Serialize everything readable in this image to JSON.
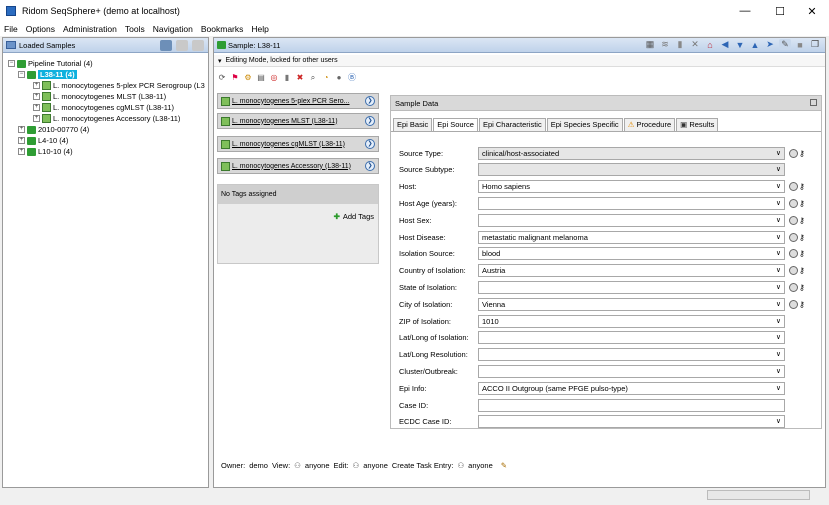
{
  "window": {
    "title": "Ridom SeqSphere+ (demo at localhost)",
    "minimize": "—",
    "maximize": "☐",
    "close": "✕"
  },
  "menu": [
    "File",
    "Options",
    "Administration",
    "Tools",
    "Navigation",
    "Bookmarks",
    "Help"
  ],
  "left_panel": {
    "title": "Loaded Samples",
    "tree": [
      {
        "label": "Pipeline Tutorial (4)",
        "toggle": "−"
      },
      {
        "label": "L38-11 (4)",
        "toggle": "−"
      },
      {
        "label": "L. monocytogenes 5-plex PCR Serogroup (L3",
        "toggle": "+"
      },
      {
        "label": "L. monocytogenes MLST (L38-11)",
        "toggle": "+"
      },
      {
        "label": "L. monocytogenes cgMLST (L38-11)",
        "toggle": "+"
      },
      {
        "label": "L. monocytogenes Accessory (L38-11)",
        "toggle": "+"
      },
      {
        "label": "2010-00770 (4)",
        "toggle": "+"
      },
      {
        "label": "L4-10 (4)",
        "toggle": "+"
      },
      {
        "label": "L10-10 (4)",
        "toggle": "+"
      }
    ]
  },
  "right_panel": {
    "title": "Sample: L38-11",
    "edit_mode": "Editing Mode, locked for other users",
    "schemes": [
      "L. monocytogenes 5-plex PCR Sero...",
      "L. monocytogenes MLST (L38-11)",
      "L. monocytogenes cgMLST (L38-11)",
      "L. monocytogenes Accessory (L38-11)"
    ],
    "tags": {
      "status": "No Tags assigned",
      "add_label": "Add Tags"
    },
    "sample_data": {
      "title": "Sample Data",
      "tabs": [
        "Epi Basic",
        "Epi Source",
        "Epi Characteristic",
        "Epi Species Specific",
        "Procedure",
        "Results"
      ],
      "active_tab": "Epi Source",
      "fields": [
        {
          "label": "Source Type:",
          "value": "clinical/host-associated",
          "dropdown": true,
          "gray": true,
          "icons": true
        },
        {
          "label": "Source Subtype:",
          "value": "",
          "dropdown": true,
          "gray": true,
          "icons": false
        },
        {
          "label": "Host:",
          "value": "Homo sapiens",
          "dropdown": true,
          "gray": false,
          "icons": true
        },
        {
          "label": "Host Age (years):",
          "value": "",
          "dropdown": true,
          "gray": false,
          "icons": true
        },
        {
          "label": "Host Sex:",
          "value": "",
          "dropdown": true,
          "gray": false,
          "icons": true
        },
        {
          "label": "Host Disease:",
          "value": "metastatic malignant melanoma",
          "dropdown": true,
          "gray": false,
          "icons": true
        },
        {
          "label": "Isolation Source:",
          "value": "blood",
          "dropdown": true,
          "gray": false,
          "icons": true
        },
        {
          "label": "Country of Isolation:",
          "value": "Austria",
          "dropdown": true,
          "gray": false,
          "icons": true
        },
        {
          "label": "State of Isolation:",
          "value": "",
          "dropdown": true,
          "gray": false,
          "icons": true
        },
        {
          "label": "City of Isolation:",
          "value": "Vienna",
          "dropdown": true,
          "gray": false,
          "icons": true
        },
        {
          "label": "ZIP of Isolation:",
          "value": "1010",
          "dropdown": true,
          "gray": false,
          "icons": false
        },
        {
          "label": "Lat/Long of Isolation:",
          "value": "",
          "dropdown": true,
          "gray": false,
          "icons": false
        },
        {
          "label": "Lat/Long Resolution:",
          "value": "",
          "dropdown": true,
          "gray": false,
          "icons": false
        },
        {
          "label": "Cluster/Outbreak:",
          "value": "",
          "dropdown": true,
          "gray": false,
          "icons": false
        },
        {
          "label": "Epi Info:",
          "value": "ACCO II Outgroup (same PFGE pulso-type)",
          "dropdown": true,
          "gray": false,
          "icons": false
        },
        {
          "label": "Case ID:",
          "value": "",
          "dropdown": false,
          "gray": false,
          "icons": false
        },
        {
          "label": "ECDC Case ID:",
          "value": "",
          "dropdown": true,
          "gray": false,
          "icons": false
        }
      ]
    },
    "footer": {
      "owner_label": "Owner:",
      "owner": "demo",
      "view_label": "View:",
      "view": "anyone",
      "edit_label": "Edit:",
      "edit": "anyone",
      "task_label": "Create Task Entry:",
      "task": "anyone"
    }
  },
  "colors": {
    "selection": "#0fb1de",
    "header_blue": "#bfd2ea",
    "tree_green": "#2f9d34"
  }
}
